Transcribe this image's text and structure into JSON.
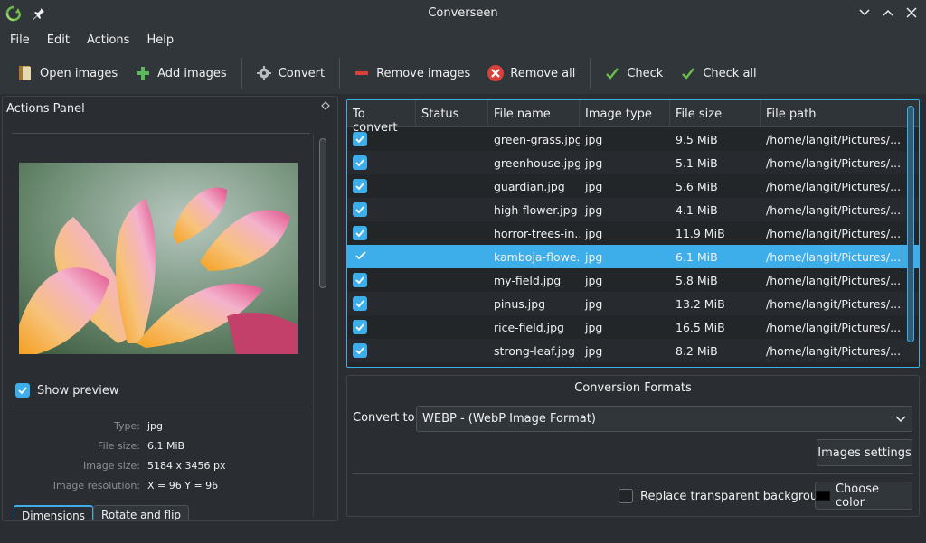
{
  "window": {
    "title": "Converseen"
  },
  "menu": [
    "File",
    "Edit",
    "Actions",
    "Help"
  ],
  "toolbar": {
    "open_images": "Open images",
    "add_images": "Add images",
    "convert": "Convert",
    "remove_images": "Remove images",
    "remove_all": "Remove all",
    "check": "Check",
    "check_all": "Check all"
  },
  "actions_panel": {
    "title": "Actions Panel",
    "show_preview": "Show preview",
    "info": [
      {
        "label": "Type:",
        "value": "jpg"
      },
      {
        "label": "File size:",
        "value": "6.1 MiB"
      },
      {
        "label": "Image size:",
        "value": "5184 x 3456 px"
      },
      {
        "label": "Image resolution:",
        "value": "X = 96 Y = 96"
      }
    ],
    "tabs": [
      "Dimensions",
      "Rotate and flip"
    ]
  },
  "table": {
    "headers": [
      "To convert",
      "Status",
      "File name",
      "Image type",
      "File size",
      "File path"
    ],
    "rows": [
      {
        "file_name": "green-grass.jpg",
        "type": "jpg",
        "size": "9.5 MiB",
        "path": "/home/langit/Pictures/..."
      },
      {
        "file_name": "greenhouse.jpg",
        "type": "jpg",
        "size": "5.1 MiB",
        "path": "/home/langit/Pictures/..."
      },
      {
        "file_name": "guardian.jpg",
        "type": "jpg",
        "size": "5.6 MiB",
        "path": "/home/langit/Pictures/..."
      },
      {
        "file_name": "high-flower.jpg",
        "type": "jpg",
        "size": "4.1 MiB",
        "path": "/home/langit/Pictures/..."
      },
      {
        "file_name": "horror-trees-in...",
        "type": "jpg",
        "size": "11.9 MiB",
        "path": "/home/langit/Pictures/..."
      },
      {
        "file_name": "kamboja-flowe...",
        "type": "jpg",
        "size": "6.1 MiB",
        "path": "/home/langit/Pictures/..."
      },
      {
        "file_name": "my-field.jpg",
        "type": "jpg",
        "size": "5.8 MiB",
        "path": "/home/langit/Pictures/..."
      },
      {
        "file_name": "pinus.jpg",
        "type": "jpg",
        "size": "13.2 MiB",
        "path": "/home/langit/Pictures/..."
      },
      {
        "file_name": "rice-field.jpg",
        "type": "jpg",
        "size": "16.5 MiB",
        "path": "/home/langit/Pictures/..."
      },
      {
        "file_name": "strong-leaf.jpg",
        "type": "jpg",
        "size": "8.2 MiB",
        "path": "/home/langit/Pictures/..."
      }
    ],
    "selected_index": 5
  },
  "formats": {
    "title": "Conversion Formats",
    "convert_to_label": "Convert to:",
    "convert_to_value": "WEBP - (WebP Image Format)",
    "images_settings": "Images settings",
    "replace_bg": "Replace transparent background",
    "choose_color": "Choose color"
  },
  "colors": {
    "accent": "#3daee9",
    "background": "#2a2e32",
    "panel": "#31363b"
  }
}
